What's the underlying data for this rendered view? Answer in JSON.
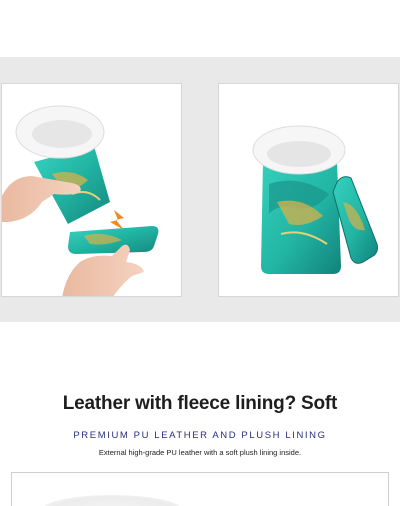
{
  "text": {
    "headline": "Leather with fleece lining? Soft",
    "subhead": "PREMIUM PU LEATHER AND PLUSH LINING",
    "caption": "External high-grade PU leather with a soft plush lining inside."
  },
  "colors": {
    "band_gray": "#e9e9e9",
    "teal": "#2fc7b4",
    "gold": "#d6b24a",
    "magnet_arrow": "#f08a1c",
    "subhead_navy": "#2a2f7a"
  },
  "icons": {
    "magnet_arrows": "double-arrow-icon"
  }
}
